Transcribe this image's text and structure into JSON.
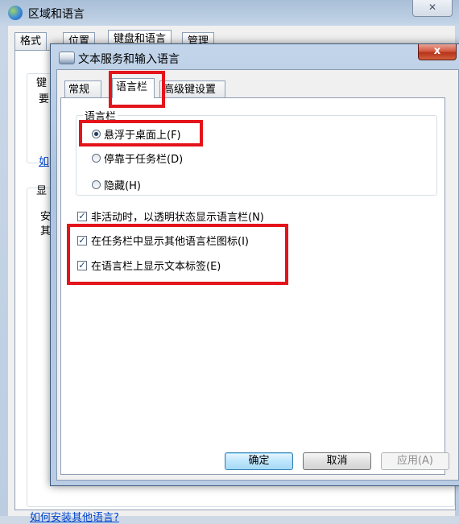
{
  "background_window": {
    "title": "区域和语言",
    "close_glyph": "✕",
    "tabs": [
      "格式",
      "位置",
      "键盘和语言",
      "管理"
    ],
    "fragments": [
      "键",
      "要",
      "如",
      "显",
      "安",
      "其"
    ],
    "link": "如何安装其他语言?"
  },
  "dialog": {
    "title": "文本服务和输入语言",
    "close_glyph": "x",
    "tabs": [
      "常规",
      "语言栏",
      "高级键设置"
    ],
    "active_tab": "语言栏",
    "group_label": "语言栏",
    "radios": [
      {
        "label": "悬浮于桌面上(F)",
        "checked": true
      },
      {
        "label": "停靠于任务栏(D)",
        "checked": false
      },
      {
        "label": "隐藏(H)",
        "checked": false
      }
    ],
    "checkboxes": [
      {
        "label": "非活动时，以透明状态显示语言栏(N)",
        "checked": true
      },
      {
        "label": "在任务栏中显示其他语言栏图标(I)",
        "checked": true
      },
      {
        "label": "在语言栏上显示文本标签(E)",
        "checked": true
      }
    ],
    "buttons": {
      "ok": "确定",
      "cancel": "取消",
      "apply": "应用(A)"
    },
    "highlight_color": "#e4141b"
  }
}
